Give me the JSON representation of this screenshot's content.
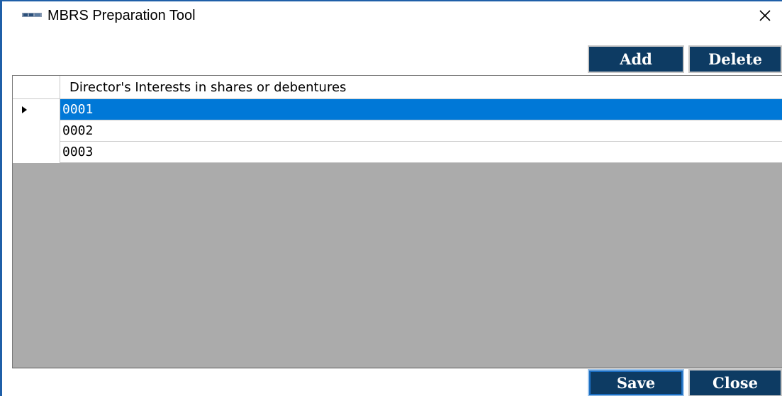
{
  "window": {
    "title": "MBRS Preparation Tool",
    "accent_color": "#1f5fa8"
  },
  "toolbar": {
    "add_label": "Add",
    "delete_label": "Delete"
  },
  "grid": {
    "column_header": "Director's Interests in shares or debentures",
    "selected_row": 0,
    "rows": [
      "0001",
      "0002",
      "0003"
    ],
    "selection_color": "#0078d7",
    "empty_area_color": "#ababab"
  },
  "footer": {
    "save_label": "Save",
    "close_label": "Close"
  },
  "icons": {
    "app": "app-logo-icon",
    "close": "close-icon",
    "row_pointer": "row-pointer-icon"
  },
  "button_color": "#0d3b63"
}
